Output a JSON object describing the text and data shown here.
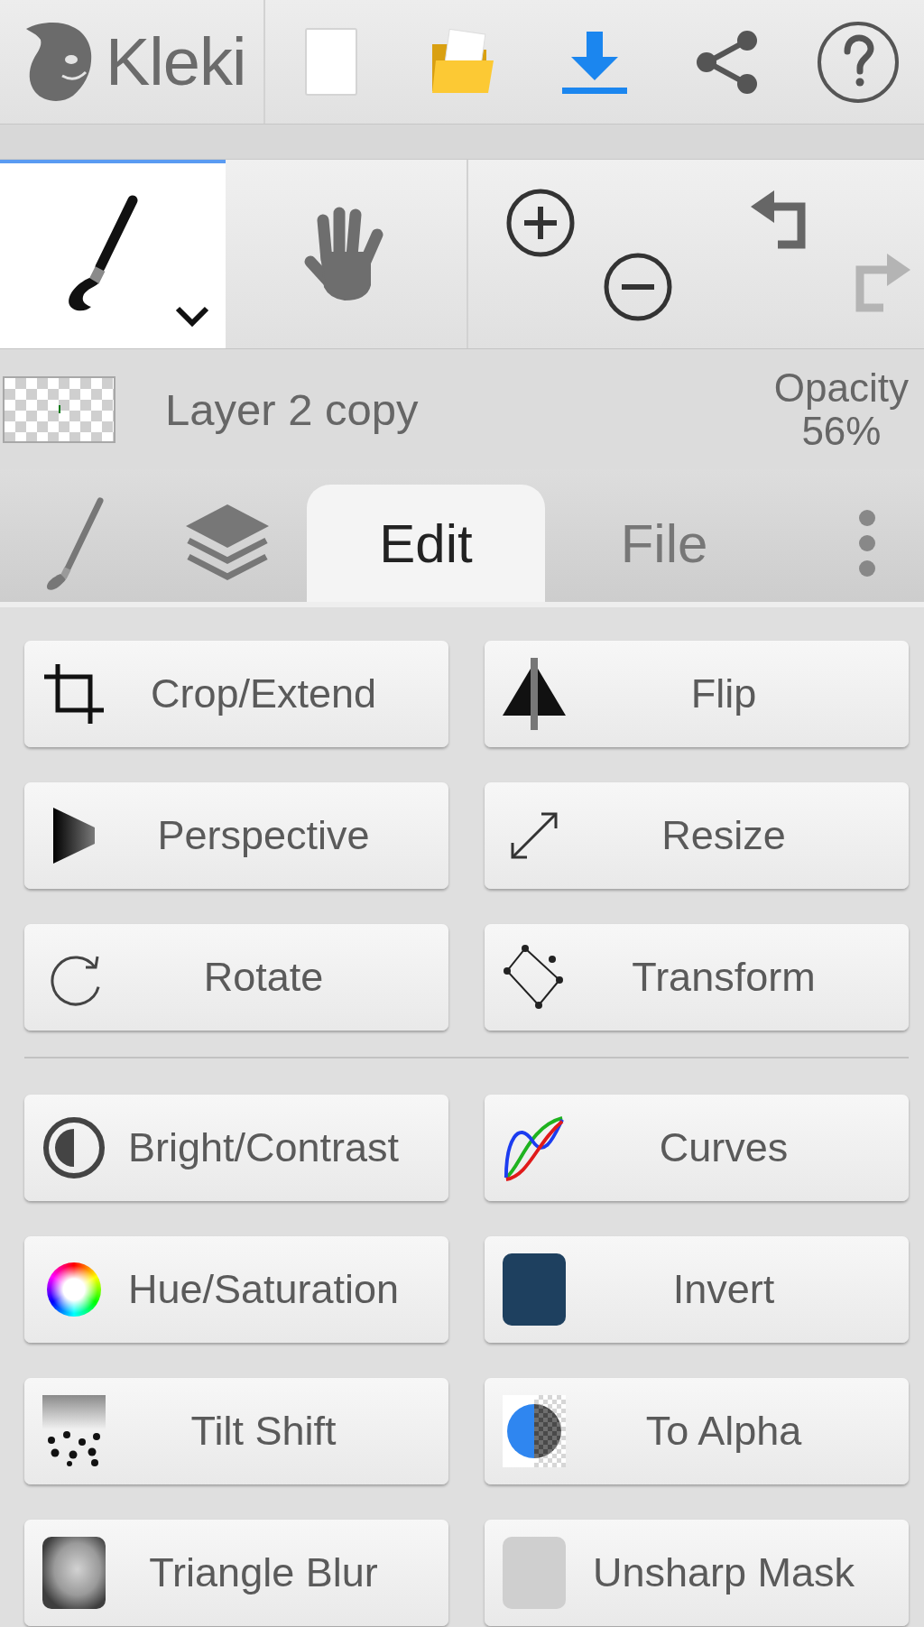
{
  "logo": {
    "text": "Kleki"
  },
  "tools": [
    {
      "kind": "brush",
      "selected": true
    },
    {
      "kind": "hand",
      "selected": false
    }
  ],
  "history": [
    {
      "kind": "undo",
      "disabled": false
    },
    {
      "kind": "redo",
      "disabled": true
    }
  ],
  "layer": {
    "name": "Layer 2 copy",
    "opacity_label": "Opacity",
    "opacity_value": "56%"
  },
  "tabs": [
    {
      "kind": "brush",
      "selected": false
    },
    {
      "kind": "layers",
      "selected": false
    },
    {
      "kind": "text",
      "label": "Edit",
      "selected": true
    },
    {
      "kind": "text",
      "label": "File",
      "selected": false
    }
  ],
  "edit_groups": [
    {
      "buttons": [
        {
          "kind": "crop",
          "label": "Crop/Extend"
        },
        {
          "kind": "flip",
          "label": "Flip"
        },
        {
          "kind": "perspective",
          "label": "Perspective"
        },
        {
          "kind": "resize",
          "label": "Resize"
        },
        {
          "kind": "rotate",
          "label": "Rotate"
        },
        {
          "kind": "transform",
          "label": "Transform"
        }
      ]
    },
    {
      "buttons": [
        {
          "kind": "brightness",
          "label": "Bright/Contrast"
        },
        {
          "kind": "curves",
          "label": "Curves"
        },
        {
          "kind": "hue",
          "label": "Hue/Saturation"
        },
        {
          "kind": "invert",
          "label": "Invert"
        },
        {
          "kind": "tiltshift",
          "label": "Tilt Shift"
        },
        {
          "kind": "toalpha",
          "label": "To Alpha"
        },
        {
          "kind": "blur",
          "label": "Triangle Blur"
        },
        {
          "kind": "unsharp",
          "label": "Unsharp Mask"
        }
      ]
    }
  ]
}
